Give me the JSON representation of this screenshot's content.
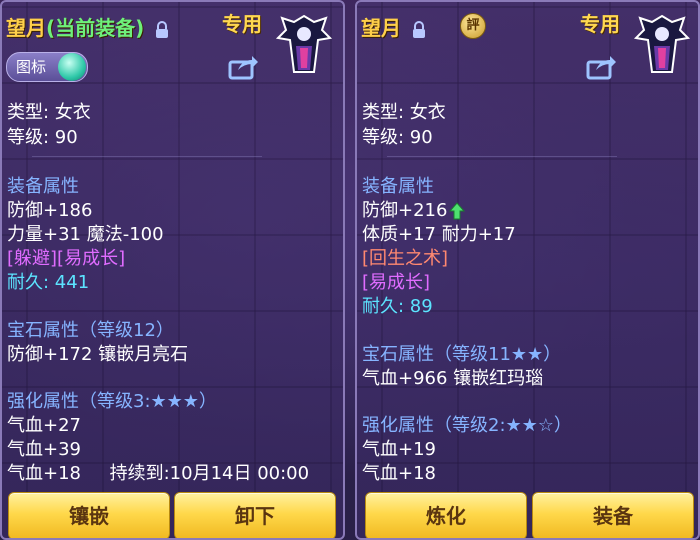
{
  "left": {
    "name": "望月",
    "status": "(当前装备)",
    "exclusive": "专用",
    "toggle_label": "图标",
    "lines": [
      {
        "text": "类型: 女衣",
        "color": "white"
      },
      {
        "text": "等级: 90",
        "color": "white"
      },
      {
        "text": "装备属性",
        "color": "blue"
      },
      {
        "text": "防御+186",
        "color": "white"
      },
      {
        "text": "力量+31 魔法-100",
        "color": "white"
      },
      {
        "text": "[躲避][易成长]",
        "color": "pink"
      },
      {
        "text": "耐久: 441",
        "color": "cyan"
      },
      {
        "text": "宝石属性（等级12）",
        "color": "blue"
      },
      {
        "text": "防御+172 镶嵌月亮石",
        "color": "white"
      },
      {
        "text": "强化属性（等级3:★★★）",
        "color": "blue"
      },
      {
        "text": "气血+27",
        "color": "white"
      },
      {
        "text": "气血+39",
        "color": "white"
      },
      {
        "text": "气血+18     持续到:10月14日 00:00",
        "color": "white"
      }
    ],
    "buttons": [
      "镶嵌",
      "卸下"
    ]
  },
  "right": {
    "name": "望月",
    "appraise_badge": "評",
    "exclusive": "专用",
    "lines": [
      {
        "text": "类型: 女衣",
        "color": "white"
      },
      {
        "text": "等级: 90",
        "color": "white"
      },
      {
        "text": "装备属性",
        "color": "blue"
      },
      {
        "text": "防御+216",
        "color": "white"
      },
      {
        "text": "体质+17 耐力+17",
        "color": "white"
      },
      {
        "text": "[回生之术]",
        "color": "orange"
      },
      {
        "text": "[易成长]",
        "color": "pink"
      },
      {
        "text": "耐久: 89",
        "color": "cyan"
      },
      {
        "text": "宝石属性（等级11★★）",
        "color": "blue"
      },
      {
        "text": "气血+966 镶嵌红玛瑙",
        "color": "white"
      },
      {
        "text": "强化属性（等级2:★★☆）",
        "color": "blue"
      },
      {
        "text": "气血+19",
        "color": "white"
      },
      {
        "text": "气血+18",
        "color": "white"
      }
    ],
    "buttons": [
      "炼化",
      "装备"
    ]
  },
  "colors": {
    "gold": "#ffd04a",
    "green": "#6ef07a",
    "blue": "#86b4ff",
    "pink": "#e06cff",
    "orange": "#ff8870",
    "cyan": "#5ce4ff",
    "button": "#ffd84a"
  },
  "icons": [
    "lock-icon",
    "share-icon",
    "avatar-icon",
    "up-arrow-icon",
    "appraise-badge-icon"
  ]
}
